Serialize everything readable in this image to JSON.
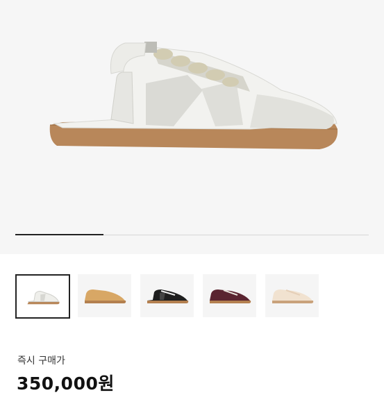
{
  "gallery": {
    "progress_fraction": 0.25,
    "thumbnails": [
      {
        "name": "thumbnail-white-mule",
        "selected": true
      },
      {
        "name": "thumbnail-tan-sneaker",
        "selected": false
      },
      {
        "name": "thumbnail-black-mule",
        "selected": false
      },
      {
        "name": "thumbnail-burgundy-sneaker",
        "selected": false
      },
      {
        "name": "thumbnail-beige-sneaker",
        "selected": false
      }
    ]
  },
  "purchase": {
    "label": "즉시 구매가",
    "price": "350,000원"
  }
}
